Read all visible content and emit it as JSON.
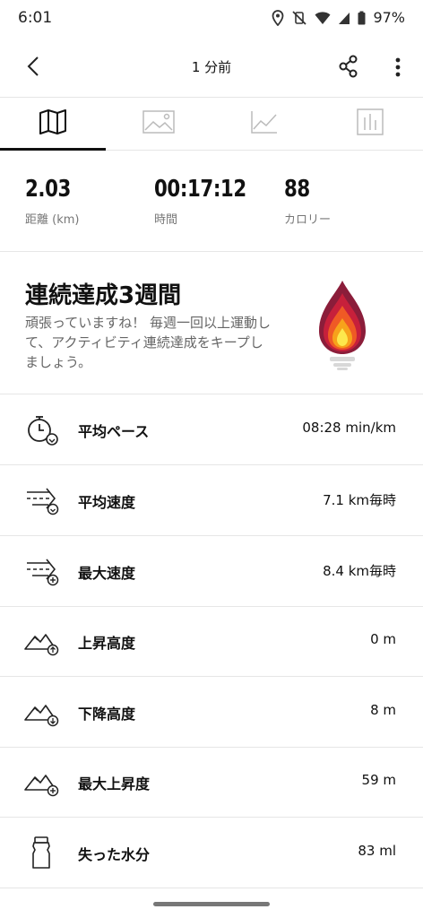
{
  "statusbar": {
    "time": "6:01",
    "battery": "97%"
  },
  "appbar": {
    "title": "1 分前"
  },
  "tabs": [
    {
      "name": "map",
      "icon": "map-icon",
      "active": true
    },
    {
      "name": "photos",
      "icon": "image-icon",
      "active": false
    },
    {
      "name": "graph",
      "icon": "line-chart-icon",
      "active": false
    },
    {
      "name": "laps",
      "icon": "bar-chart-icon",
      "active": false
    }
  ],
  "stats": {
    "distance": {
      "value": "2.03",
      "label": "距離 (km)"
    },
    "time": {
      "value": "00:17:12",
      "label": "時間"
    },
    "calories": {
      "value": "88",
      "label": "カロリー"
    }
  },
  "streak": {
    "title": "連続達成3週間",
    "description": "頑張っていますね！ 毎週一回以上運動して、アクティビティ連続達成をキープしましょう。"
  },
  "metrics": [
    {
      "label": "平均ペース",
      "value": "08:28 min/km",
      "icon": "stopwatch-icon"
    },
    {
      "label": "平均速度",
      "value": "7.1 km毎時",
      "icon": "speed-average-icon"
    },
    {
      "label": "最大速度",
      "value": "8.4 km毎時",
      "icon": "speed-max-icon"
    },
    {
      "label": "上昇高度",
      "value": "0 m",
      "icon": "elevation-gain-icon"
    },
    {
      "label": "下降高度",
      "value": "8 m",
      "icon": "elevation-loss-icon"
    },
    {
      "label": "最大上昇度",
      "value": "59 m",
      "icon": "max-elevation-icon"
    },
    {
      "label": "失った水分",
      "value": "83 ml",
      "icon": "water-bottle-icon"
    }
  ]
}
